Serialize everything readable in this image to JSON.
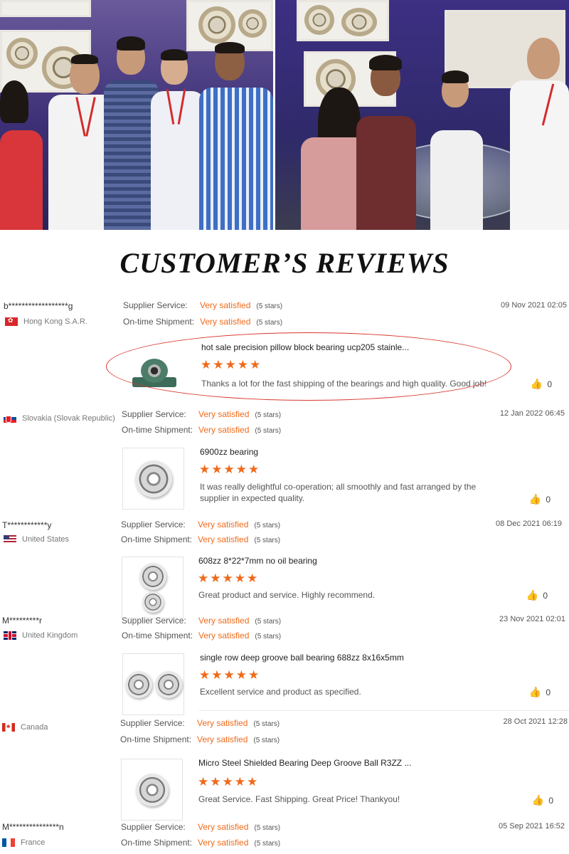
{
  "title": "CUSTOMER’S REVIEWS",
  "labels": {
    "supplier_service": "Supplier Service:",
    "ontime_shipment": "On-time Shipment:",
    "stars_suffix": "(5 stars)"
  },
  "reviews": [
    {
      "buyer": "b******************g",
      "country": "Hong Kong S.A.R.",
      "flag_icon": "hong-kong-flag-icon",
      "supplier_service": "Very satisfied",
      "ontime_shipment": "Very satisfied",
      "date": "09 Nov 2021 02:05",
      "product": "hot sale precision pillow block bearing ucp205 stainle...",
      "product_image": "pillow-block-bearing-image",
      "rating": 5,
      "stars": "★★★★★",
      "comment": "Thanks a lot for the fast shipping of the bearings and high quality. Good job!",
      "likes": "0"
    },
    {
      "buyer": "",
      "country": "Slovakia (Slovak Republic)",
      "flag_icon": "slovakia-flag-icon",
      "supplier_service": "Very satisfied",
      "ontime_shipment": "Very satisfied",
      "date": "12 Jan 2022 06:45",
      "product": "6900zz bearing",
      "product_image": "ball-bearing-image",
      "rating": 5,
      "stars": "★★★★★",
      "comment": "It was really delightful co-operation; all smoothly and fast arranged by the supplier in expected quality.",
      "likes": "0"
    },
    {
      "buyer": "T************y",
      "country": "United States",
      "flag_icon": "united-states-flag-icon",
      "supplier_service": "Very satisfied",
      "ontime_shipment": "Very satisfied",
      "date": "08 Dec 2021 06:19",
      "product": "608zz 8*22*7mm no oil bearing",
      "product_image": "stacked-bearings-image",
      "rating": 5,
      "stars": "★★★★★",
      "comment": "Great product and service.  Highly recommend.",
      "likes": "0"
    },
    {
      "buyer": "M*********r",
      "country": "United Kingdom",
      "flag_icon": "united-kingdom-flag-icon",
      "supplier_service": "Very satisfied",
      "ontime_shipment": "Very satisfied",
      "date": "23 Nov 2021 02:01",
      "product": "single row deep groove ball bearing 688zz 8x16x5mm",
      "product_image": "two-bearings-image",
      "rating": 5,
      "stars": "★★★★★",
      "comment": "Excellent service and product as specified.",
      "likes": "0"
    },
    {
      "buyer": "",
      "country": "Canada",
      "flag_icon": "canada-flag-icon",
      "supplier_service": "Very satisfied",
      "ontime_shipment": "Very satisfied",
      "date": "28 Oct 2021 12:28",
      "product": "Micro Steel Shielded Bearing Deep Groove Ball R3ZZ ...",
      "product_image": "micro-bearing-image",
      "rating": 5,
      "stars": "★★★★★",
      "comment": "Great Service. Fast Shipping. Great Price! Thankyou!",
      "likes": "0"
    },
    {
      "buyer": "M***************n",
      "country": "France",
      "flag_icon": "france-flag-icon",
      "supplier_service": "Very satisfied",
      "ontime_shipment": "Very satisfied",
      "date": "05 Sep 2021 16:52"
    }
  ]
}
